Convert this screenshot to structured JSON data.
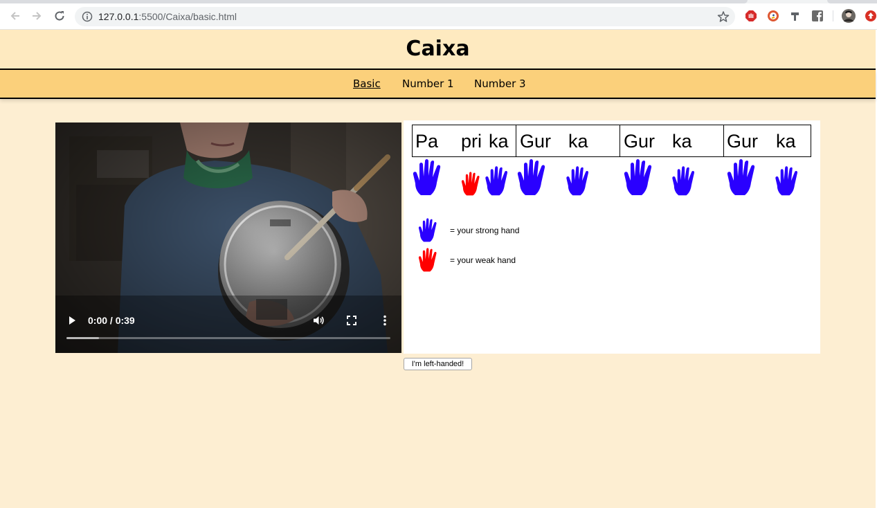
{
  "browser": {
    "url_host": "127.0.0.1",
    "url_rest": ":5500/Caixa/basic.html"
  },
  "header": {
    "title": "Caixa"
  },
  "nav": {
    "items": [
      "Basic",
      "Number 1",
      "Number 3"
    ],
    "active": "Basic"
  },
  "video": {
    "time": "0:00 / 0:39",
    "progress": 0.1
  },
  "rhythm": {
    "syllables": [
      "Pa",
      "pri",
      "ka",
      "Gur",
      "ka",
      "Gur",
      "ka",
      "Gur",
      "ka"
    ],
    "legend": {
      "strong": "= your strong hand",
      "weak": "= your weak hand"
    },
    "colors": {
      "strong": "#2a00ff",
      "weak": "#ff0000"
    }
  },
  "button": {
    "label": "I'm left-handed!"
  }
}
